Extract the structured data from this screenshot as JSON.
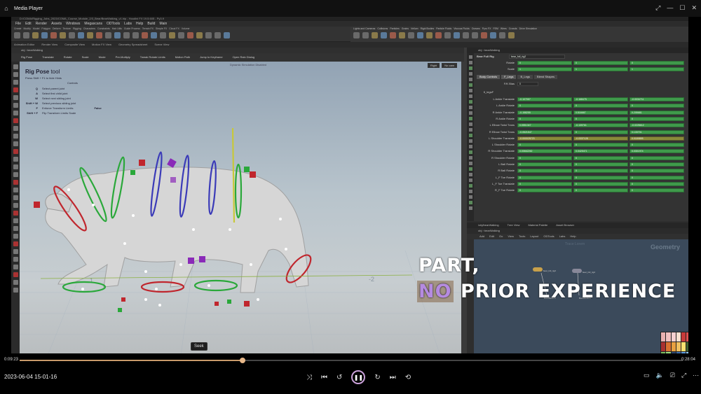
{
  "player": {
    "title": "Media Player",
    "current_time": "0:09:23",
    "total_time": "0:28:04",
    "progress": 0.336,
    "seek_tooltip": "Seek",
    "timestamp": "2023-06-04 15-01-16",
    "accent": "#c9a0d9"
  },
  "houdini": {
    "path": "D:/CGMA/Rigging_Jobs_2023/CGMA_Course_Module_2/3_Bear/BearWalking_v1.hip - Houdini FX 19.5.605 - Py3.9",
    "menu": [
      "File",
      "Edit",
      "Render",
      "Assets",
      "Windows",
      "Megascans",
      "ODTools",
      "Labs",
      "Help",
      "Build",
      "Main"
    ],
    "shelf_tabs_left": [
      "Create",
      "Modify",
      "Model",
      "Polygon",
      "Deform",
      "Texture",
      "Rigging",
      "Characters",
      "Constraints",
      "Hair Utils",
      "Guide Process",
      "Terrain FX",
      "Simple FX",
      "Cloud FX",
      "Volume"
    ],
    "shelf_tabs_right": [
      "Lights and Cameras",
      "Collisions",
      "Particles",
      "Grains",
      "Vellum",
      "Rigid Bodies",
      "Particle Fluids",
      "Viscous Fluids",
      "Oceans",
      "Pyro FX",
      "FEM",
      "Wires",
      "Crowds",
      "Drive Simulation"
    ],
    "pane_tabs": [
      "Animation Editor",
      "Render View",
      "Composite View",
      "Motion FX View",
      "Geometry Spreadsheet",
      "Scene View"
    ],
    "obj_path": "obj",
    "network": "bearWalking",
    "toolbar": [
      "Rig Pose",
      "Translate",
      "Rotate",
      "Scale",
      "Mode",
      "Pre-Multiply",
      "Tweak Rotate Limits",
      "Motion Path",
      "Jump to Keyframe",
      "Open Rain Dialog"
    ],
    "sim_status": "Dynamic Simulation Disabled",
    "cam_buttons": [
      "Right",
      "No cam"
    ]
  },
  "tooltip": {
    "title_bold": "Rig Pose",
    "title_rest": " tool",
    "subtitle": "Press Shift + F1 to hide Hints",
    "controls_header": "Controls",
    "rows": [
      {
        "key": "Q",
        "desc": "Select parent joint"
      },
      {
        "key": "A",
        "desc": "Select first child joint"
      },
      {
        "key": "W",
        "desc": "Select next sibling joint"
      },
      {
        "key": "Shift + W",
        "desc": "Select previous sibling joint"
      },
      {
        "key": "F",
        "desc": "Enforce Transform Limits"
      },
      {
        "key": "Shift + F",
        "desc": "Flip Transform Limits Scale"
      }
    ],
    "enforce_value": "False"
  },
  "params": {
    "header": "Bear Full Rig",
    "node_name": "bear_full_rig2",
    "rotate_label": "Rotate",
    "rotate_vals": [
      "0",
      "0",
      "0"
    ],
    "scale_label": "Scale",
    "scale_vals": [
      "1",
      "1",
      "1"
    ],
    "tabs": [
      "Body Controls",
      "F_Legs",
      "B_Legs",
      "Blend Shapes"
    ],
    "fk_label": "F/K Bias",
    "fk_value": "0",
    "section": "fl_legsF",
    "rows": [
      {
        "label": "L Ankle Translate",
        "v": [
          "-0.107057",
          "-0.168475",
          "-0.0034711"
        ]
      },
      {
        "label": "L Ankle Rotate",
        "v": [
          "0",
          "0",
          "0"
        ]
      },
      {
        "label": "R Ankle Translate",
        "v": [
          "-0.158255",
          "0.516667",
          "0.205681"
        ]
      },
      {
        "label": "R Ankle Rotate",
        "v": [
          "0",
          "0",
          "0"
        ]
      },
      {
        "label": "L Elbow Twist Trans",
        "v": [
          "0.0551347",
          "-0.139761",
          "-0.0228612"
        ]
      },
      {
        "label": "R Elbow Twist Trans",
        "v": [
          "-0.0521547",
          "0",
          "0.133701"
        ]
      },
      {
        "label": "L Shoulder Translate",
        "v": [
          "-0.000025723",
          "-0.0337128",
          "0.0189895"
        ]
      },
      {
        "label": "L Shoulder Rotate",
        "v": [
          "0",
          "0",
          "0"
        ]
      },
      {
        "label": "R Shoulder Translate",
        "v": [
          "0.00662262",
          "0.0425471",
          "0.0301974"
        ]
      },
      {
        "label": "R Shoulder Rotate",
        "v": [
          "0",
          "0",
          "0"
        ]
      },
      {
        "label": "L Ball Rotate",
        "v": [
          "0",
          "0",
          "0"
        ]
      },
      {
        "label": "R Ball Rotate",
        "v": [
          "0",
          "0",
          "0"
        ]
      },
      {
        "label": "L_F Toe Rotate",
        "v": [
          "0",
          "0",
          "0"
        ]
      },
      {
        "label": "L_F Toe Translate",
        "v": [
          "0",
          "0",
          "0"
        ]
      },
      {
        "label": "R_F Toe Rotate",
        "v": [
          "0",
          "0",
          "0"
        ]
      }
    ]
  },
  "network_editor": {
    "tabs": [
      "/obj/bearWalking",
      "Tree View",
      "Material Palette",
      "Asset Browser"
    ],
    "path": "bearWalking",
    "menu": [
      "Add",
      "Edit",
      "Go",
      "View",
      "Tools",
      "Layout",
      "ODTools",
      "Labs",
      "Help"
    ],
    "label": "Trace Lorem",
    "context": "Geometry",
    "node_a": "bear_full_rig2",
    "node_b": "bear_full_rig2",
    "node_a_out": "BoneDeform",
    "node_b_out": "BoneDeform"
  },
  "overlay": {
    "line1": "PART,",
    "line2_accent": "NO",
    "line2_rest": " PRIOR EXPERIENCE",
    "accent": "#b58be0"
  }
}
